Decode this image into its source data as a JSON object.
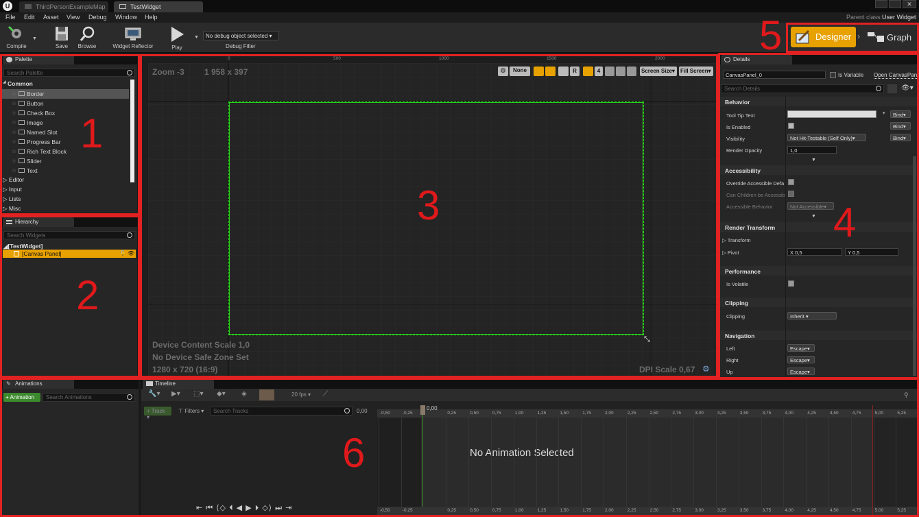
{
  "window": {
    "tabs": [
      "ThirdPersonExampleMap",
      "TestWidget"
    ],
    "parent_class_label": "Parent class:",
    "parent_class_value": "User Widget"
  },
  "menu": [
    "File",
    "Edit",
    "Asset",
    "View",
    "Debug",
    "Window",
    "Help"
  ],
  "toolbar": {
    "compile": "Compile",
    "save": "Save",
    "browse": "Browse",
    "widget_reflector": "Widget Reflector",
    "play": "Play",
    "debug_object": "No debug object selected",
    "debug_filter": "Debug Filter"
  },
  "mode": {
    "designer": "Designer",
    "graph": "Graph"
  },
  "palette": {
    "tab": "Palette",
    "search_placeholder": "Search Palette",
    "common_label": "Common",
    "common_items": [
      "Border",
      "Button",
      "Check Box",
      "Image",
      "Named Slot",
      "Progress Bar",
      "Rich Text Block",
      "Slider",
      "Text"
    ],
    "other_categories": [
      "Editor",
      "Input",
      "Lists",
      "Misc"
    ]
  },
  "hierarchy": {
    "tab": "Hierarchy",
    "search_placeholder": "Search Widgets",
    "root": "[TestWidget]",
    "child": "[Canvas Panel]"
  },
  "designer": {
    "zoom": "Zoom -3",
    "size": "1 958 x 397",
    "ruler_ticks": [
      "0",
      "500",
      "1000",
      "1500",
      "2000"
    ],
    "toolbar": {
      "none": "None",
      "r": "R",
      "four": "4",
      "screen_size": "Screen Size",
      "fill_screen": "Fill Screen"
    },
    "device_scale": "Device Content Scale 1,0",
    "safe_zone": "No Device Safe Zone Set",
    "resolution": "1280 x 720 (16:9)",
    "dpi": "DPI Scale 0,67"
  },
  "details": {
    "tab": "Details",
    "name_value": "CanvasPanel_0",
    "is_variable": "Is Variable",
    "open_link": "Open CanvasPanel",
    "search_placeholder": "Search Details",
    "sections": {
      "behavior": "Behavior",
      "accessibility": "Accessibility",
      "render_transform": "Render Transform",
      "performance": "Performance",
      "clipping": "Clipping",
      "navigation": "Navigation"
    },
    "props": {
      "tooltip": "Tool Tip Text",
      "is_enabled": "Is Enabled",
      "visibility": "Visibility",
      "visibility_value": "Not Hit-Testable (Self Only)",
      "render_opacity": "Render Opacity",
      "render_opacity_value": "1,0",
      "override_accessible": "Override Accessible Defa",
      "children_accessible": "Can Children be Accessib",
      "accessible_behavior": "Accessible Behavior",
      "accessible_behavior_value": "Not Accessible",
      "transform": "Transform",
      "pivot": "Pivot",
      "pivot_x": "X  0,5",
      "pivot_y": "Y  0,5",
      "is_volatile": "Is Volatile",
      "clipping": "Clipping",
      "clipping_value": "Inherit",
      "left": "Left",
      "right": "Right",
      "up": "Up",
      "escape": "Escape"
    },
    "bind": "Bind"
  },
  "animations": {
    "tab": "Animations",
    "add_button": "+ Animation",
    "search_placeholder": "Search Animations"
  },
  "timeline": {
    "tab": "Timeline",
    "fps": "20 fps",
    "track": "Track",
    "filters": "Filters",
    "search_placeholder": "Search Tracks",
    "time_value": "0,00",
    "marker_value": "0,00",
    "ticks": [
      "-0,50",
      "-0,25",
      "0,25",
      "0,50",
      "0,75",
      "1,00",
      "1,25",
      "1,50",
      "1,75",
      "2,00",
      "2,25",
      "2,50",
      "2,75",
      "3,00",
      "3,25",
      "3,50",
      "3,75",
      "4,00",
      "4,25",
      "4,50",
      "4,75",
      "5,00",
      "5,25"
    ],
    "empty_message": "No Animation Selected"
  },
  "annotations": [
    "1",
    "2",
    "3",
    "4",
    "5",
    "6"
  ],
  "colors": {
    "accent_orange": "#e7a100",
    "annotation_red": "#e22222",
    "selection_green": "#29d219"
  }
}
